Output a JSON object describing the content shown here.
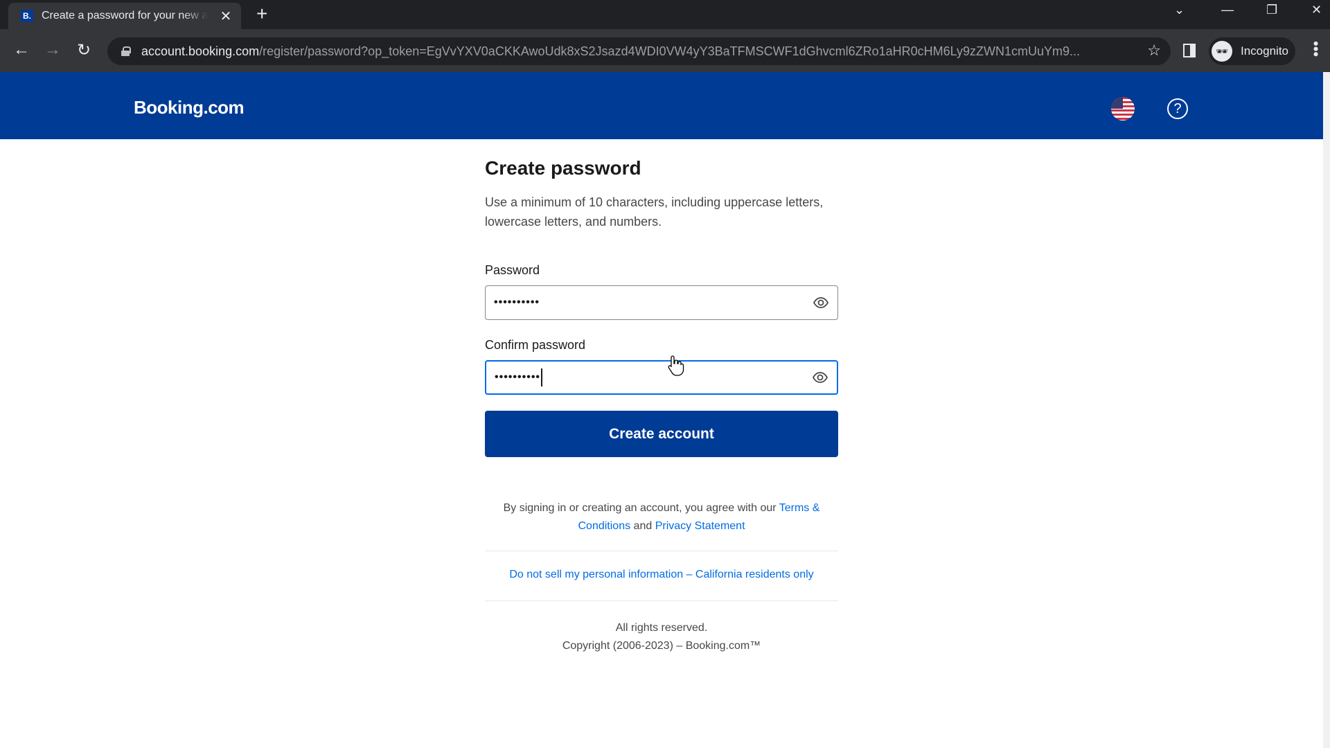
{
  "browser": {
    "tab": {
      "favicon": "B.",
      "title": "Create a password for your new account"
    },
    "new_tab_icon": "+",
    "url": {
      "host": "account.booking.com",
      "path": "/register/password?op_token=EgVvYXV0aCKKAwoUdk8xS2Jsazd4WDI0VW4yY3BaTFMSCWF1dGhvcml6ZRo1aHR0cHM6Ly9zZWN1cmUuYm9..."
    },
    "profile_label": "Incognito"
  },
  "header": {
    "logo": "Booking.com",
    "language": "English (US)",
    "help_icon": "?"
  },
  "form": {
    "title": "Create password",
    "description": "Use a minimum of 10 characters, including uppercase letters, lowercase letters, and numbers.",
    "password": {
      "label": "Password",
      "value": "••••••••••"
    },
    "confirm_password": {
      "label": "Confirm password",
      "value": "••••••••••"
    },
    "submit_label": "Create account"
  },
  "legal": {
    "prefix": "By signing in or creating an account, you agree with our ",
    "terms_link": "Terms & Conditions",
    "and": " and ",
    "privacy_link": "Privacy Statement",
    "ccpa_link": "Do not sell my personal information – California residents only"
  },
  "footer": {
    "rights": "All rights reserved.",
    "copyright": "Copyright (2006-2023) – Booking.com™"
  },
  "colors": {
    "brand": "#003b95",
    "link": "#006ce4",
    "focus": "#006ce4"
  }
}
